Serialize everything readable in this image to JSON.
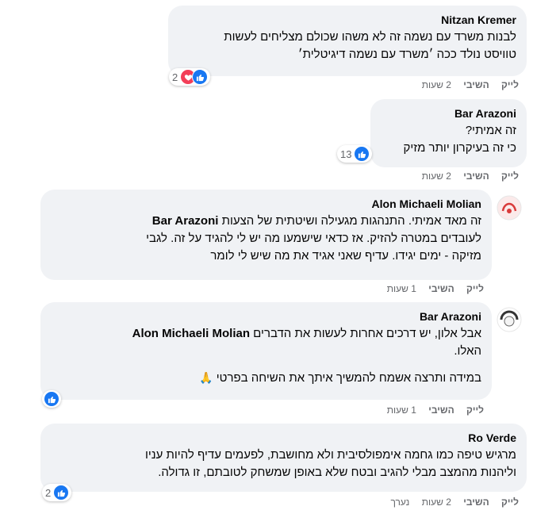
{
  "comments": [
    {
      "author": "Nitzan Kremer",
      "lines": [
        "לבנות משרד עם נשמה זה לא משהו שכולם מצליחים לעשות",
        "טוויסט נולד ככה ׳משרד עם נשמה דיגיטלית׳"
      ],
      "reactions": {
        "count": "2",
        "icons": [
          "like-icon",
          "love-icon"
        ]
      },
      "like": "לייק",
      "reply": "השיבי",
      "time": "2 שעות"
    },
    {
      "author": "Bar Arazoni",
      "lines": [
        "זה אמיתי?",
        "כי זה בעיקרון יותר מזיק"
      ],
      "reactions": {
        "count": "13",
        "icons": [
          "like-icon"
        ]
      },
      "like": "לייק",
      "reply": "השיבי",
      "time": "2 שעות"
    },
    {
      "author": "Alon Michaeli Molian",
      "mention": "Bar Arazoni",
      "line1_rest": "זה מאד אמיתי. התנהגות מגעילה ושיטתית של הצעות",
      "line2": "לעובדים במטרה להזיק. אז כדאי שישמעו מה יש לי להגיד על זה. לגבי",
      "line3": "מזיקה - ימים יגידו. עדיף שאני אגיד את מה שיש לי לומר",
      "like": "לייק",
      "reply": "השיבי",
      "time": "1 שעות"
    },
    {
      "author": "Bar Arazoni",
      "mention": "Alon Michaeli Molian",
      "line1_rest": "אבל אלון, יש דרכים אחרות לעשות את הדברים",
      "line2": "האלו.",
      "line3": "במידה ותרצה אשמח להמשיך איתך את השיחה בפרטי",
      "emoji": "🙏",
      "reactions": {
        "icons": [
          "like-icon"
        ]
      },
      "like": "לייק",
      "reply": "השיבי",
      "time": "1 שעות"
    },
    {
      "author": "Ro Verde",
      "lines": [
        "מרגיש טיפה כמו גחמה אימפולסיבית ולא מחושבת, לפעמים עדיף להיות עניו",
        "וליהנות מהמצב מבלי להגיב ובטח שלא באופן שמשחק לטובתם, זו גדולה."
      ],
      "reactions": {
        "count": "2",
        "icons": [
          "like-icon"
        ]
      },
      "like": "לייק",
      "reply": "השיבי",
      "time": "2 שעות",
      "edited": "נערך"
    }
  ],
  "colors": {
    "bubble": "#f0f2f5",
    "meta": "#65676b",
    "like": "#1877f2",
    "love": "#f33e58"
  }
}
